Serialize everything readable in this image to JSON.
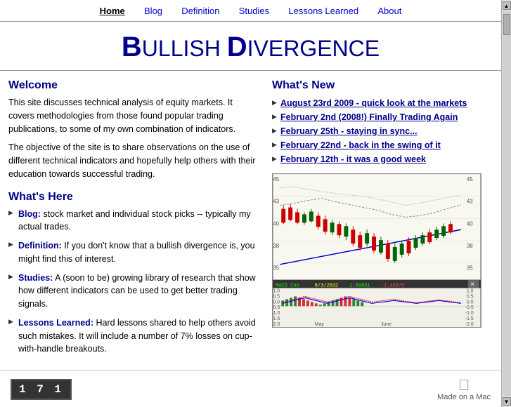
{
  "nav": {
    "items": [
      {
        "label": "Home",
        "active": true
      },
      {
        "label": "Blog",
        "active": false
      },
      {
        "label": "Definition",
        "active": false
      },
      {
        "label": "Studies",
        "active": false
      },
      {
        "label": "Lessons Learned",
        "active": false
      },
      {
        "label": "About",
        "active": false
      }
    ]
  },
  "title": {
    "full": "ULLISH IVERGENCE",
    "cap1": "B",
    "cap2": "D",
    "display": "Bullish Divergence"
  },
  "left_col": {
    "welcome_heading": "Welcome",
    "welcome_p1": "This site discusses technical analysis of equity markets.  It covers methodologies from those found popular trading publications, to some of my own combination of indicators.",
    "welcome_p2": "The objective of the site is to share observations on the use of different technical indicators and hopefully help others with their education towards successful trading.",
    "whats_here_heading": "What's Here",
    "items": [
      {
        "label": "Blog:",
        "text": " stock market and individual stock picks -- typically my actual trades."
      },
      {
        "label": "Definition:",
        "text": "  If you don't know that a bullish divergence is, you might find this of interest."
      },
      {
        "label": "Studies:",
        "text": "  A (soon to be) growing library of research that show how different indicators can be used to  get better trading signals."
      },
      {
        "label": "Lessons Learned:",
        "text": "  Hard lessons shared to help others avoid such mistakes.  It will include a number of 7% losses on cup-with-handle breakouts."
      }
    ]
  },
  "right_col": {
    "whats_new_heading": "What's New",
    "links": [
      "August 23rd 2009 - quick look at the markets",
      "February 2nd (2008!) Finally Trading Again",
      "February 25th - staying in sync...",
      "February 22nd - back in the swing of it",
      "February 12th - it was a good week"
    ]
  },
  "footer": {
    "counter": "1 7 1",
    "made_on_mac": "Made on a Mac"
  }
}
